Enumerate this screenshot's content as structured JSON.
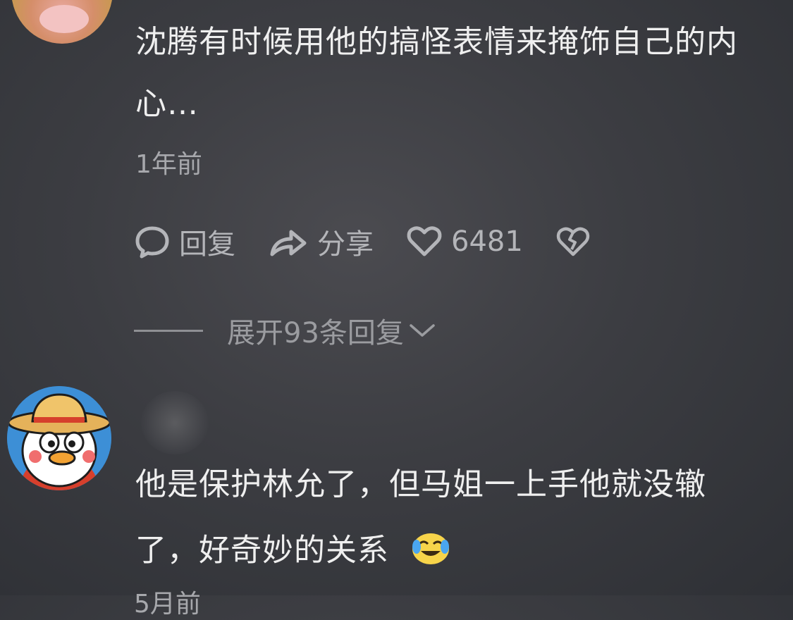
{
  "comment1": {
    "text_line1": "沈腾有时候用他的搞怪表情来掩饰自己的内",
    "text_line2": "心…",
    "time": "1年前",
    "reply_label": "回复",
    "share_label": "分享",
    "like_count": "6481",
    "expand_label": "展开93条回复"
  },
  "comment2": {
    "text_line1": "他是保护林允了，但马姐一上手他就没辙",
    "text_line2": "了，好奇妙的关系",
    "time": "5月前"
  },
  "icons": {
    "reply": "comment-bubble-icon",
    "share": "share-arrow-icon",
    "like": "heart-icon",
    "dislike": "broken-heart-icon",
    "expand": "chevron-down-icon",
    "emoji": "crying-laugh-emoji-icon"
  }
}
